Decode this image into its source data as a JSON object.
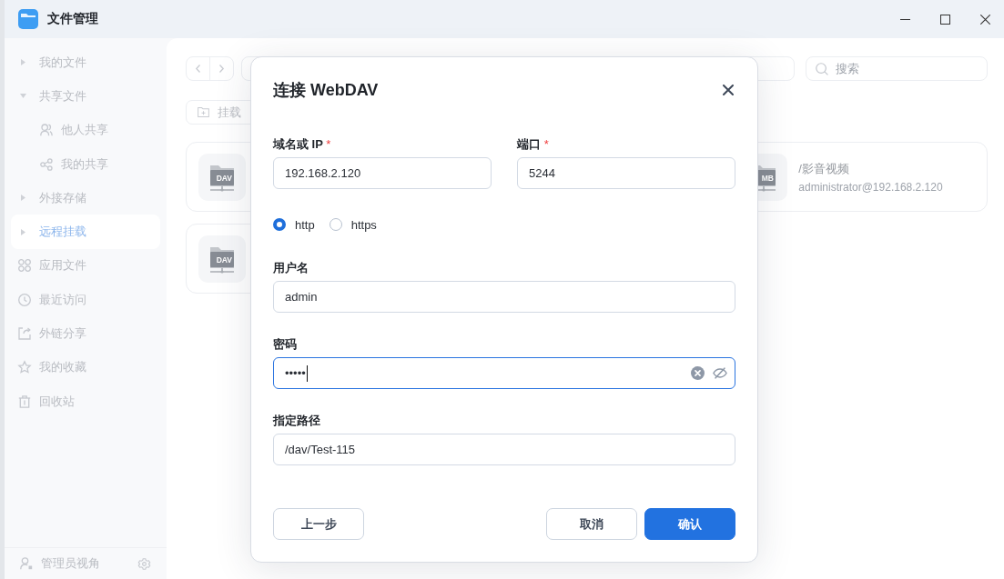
{
  "window": {
    "title": "文件管理"
  },
  "sidebar": {
    "items": [
      {
        "kind": "group",
        "label": "我的文件",
        "expanded": false,
        "selected": false
      },
      {
        "kind": "group",
        "label": "共享文件",
        "expanded": true,
        "selected": false,
        "children": [
          {
            "label": "他人共享",
            "selected": false
          },
          {
            "label": "我的共享",
            "selected": false
          }
        ]
      },
      {
        "kind": "group",
        "label": "外接存储",
        "expanded": false,
        "selected": false
      },
      {
        "kind": "group",
        "label": "远程挂载",
        "expanded": false,
        "selected": true
      },
      {
        "kind": "link",
        "label": "应用文件",
        "selected": false
      },
      {
        "kind": "link",
        "label": "最近访问",
        "selected": false
      },
      {
        "kind": "link",
        "label": "外链分享",
        "selected": false
      },
      {
        "kind": "link",
        "label": "我的收藏",
        "selected": false
      },
      {
        "kind": "link",
        "label": "回收站",
        "selected": false
      }
    ],
    "footer": {
      "label": "管理员视角"
    }
  },
  "toolbar": {
    "mount_button": "挂载",
    "search": {
      "placeholder": "搜索"
    }
  },
  "mounts": [
    {
      "icon_label": "DAV"
    },
    {
      "icon_label": "MB",
      "title": "/影音视频",
      "subtitle": "administrator@192.168.2.120"
    },
    {
      "icon_label": "DAV"
    }
  ],
  "dialog": {
    "title": "连接 WebDAV",
    "host": {
      "label": "域名或 IP",
      "required_mark": "*",
      "value": "192.168.2.120"
    },
    "port": {
      "label": "端口",
      "required_mark": "*",
      "value": "5244"
    },
    "protocols": [
      {
        "label": "http",
        "selected": true
      },
      {
        "label": "https",
        "selected": false
      }
    ],
    "username": {
      "label": "用户名",
      "value": "admin"
    },
    "password": {
      "label": "密码",
      "value": "•••••",
      "focused": true
    },
    "path": {
      "label": "指定路径",
      "value": "/dav/Test-115"
    },
    "buttons": [
      {
        "kind": "back",
        "label": "上一步"
      },
      {
        "kind": "cancel",
        "label": "取消"
      },
      {
        "kind": "primary",
        "label": "确认"
      }
    ]
  }
}
